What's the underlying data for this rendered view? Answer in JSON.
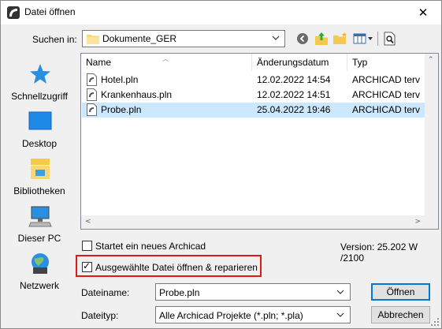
{
  "window": {
    "title": "Datei öffnen",
    "close_glyph": "✕"
  },
  "lookin": {
    "label": "Suchen in:",
    "value": "Dokumente_GER"
  },
  "toolbar": {
    "icons": [
      "back-icon",
      "up-folder-icon",
      "new-folder-icon",
      "view-menu-icon",
      "preview-icon"
    ]
  },
  "places": [
    {
      "label": "Schnellzugriff",
      "icon": "star-icon"
    },
    {
      "label": "Desktop",
      "icon": "desktop-icon"
    },
    {
      "label": "Bibliotheken",
      "icon": "libraries-icon"
    },
    {
      "label": "Dieser PC",
      "icon": "computer-icon"
    },
    {
      "label": "Netzwerk",
      "icon": "network-icon"
    }
  ],
  "filelist": {
    "columns": [
      "Name",
      "Änderungsdatum",
      "Typ"
    ],
    "rows": [
      {
        "name": "Hotel.pln",
        "date": "12.02.2022 14:54",
        "type": "ARCHICAD terv",
        "selected": false
      },
      {
        "name": "Krankenhaus.pln",
        "date": "12.02.2022 14:51",
        "type": "ARCHICAD terv",
        "selected": false
      },
      {
        "name": "Probe.pln",
        "date": "25.04.2022 19:46",
        "type": "ARCHICAD terv",
        "selected": true
      }
    ]
  },
  "options": {
    "new_archicad_label": "Startet ein neues Archicad",
    "new_archicad_checked": false,
    "open_repair_label": "Ausgewählte Datei öffnen & reparieren",
    "open_repair_checked": true,
    "version": "Version: 25.202 W /2100"
  },
  "filename": {
    "label": "Dateiname:",
    "value": "Probe.pln"
  },
  "filetype": {
    "label": "Dateityp:",
    "value": "Alle Archicad Projekte (*.pln; *.pla)"
  },
  "buttons": {
    "open": "Öffnen",
    "cancel": "Abbrechen"
  },
  "colors": {
    "selection": "#cce8ff",
    "highlight_border": "#e01818",
    "accent": "#0078d7"
  }
}
